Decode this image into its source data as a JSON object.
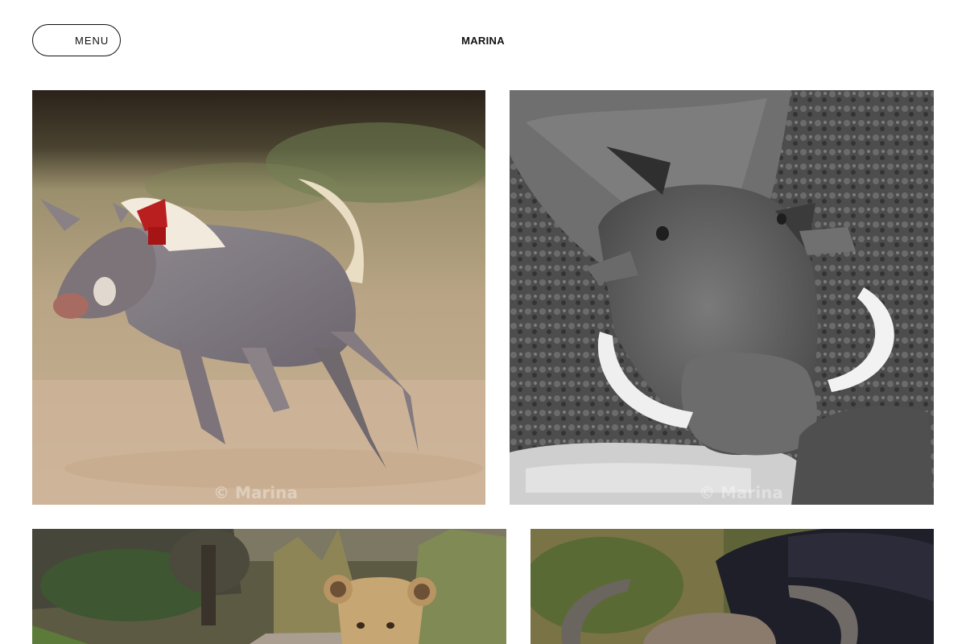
{
  "header": {
    "menu_label": "MENU",
    "site_title": "MARINA"
  },
  "gallery": {
    "photos": [
      {
        "subject": "running warthog piglet",
        "watermark": "© Marina"
      },
      {
        "subject": "warthog drinking (black and white)",
        "watermark": "© Marina"
      },
      {
        "subject": "lion cub"
      },
      {
        "subject": "cape buffalo"
      }
    ]
  },
  "colors": {
    "text": "#111111",
    "background": "#ffffff"
  }
}
